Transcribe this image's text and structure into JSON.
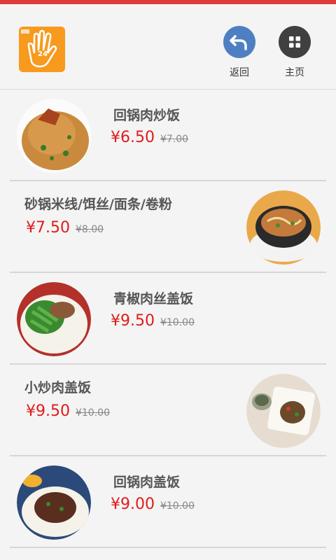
{
  "header": {
    "logo_text": "24 送餐",
    "back_label": "返回",
    "home_label": "主页"
  },
  "items": [
    {
      "name": "回锅肉炒饭",
      "price": "¥6.50",
      "old_price": "¥7.00"
    },
    {
      "name": "砂锅米线/饵丝/面条/卷粉",
      "price": "¥7.50",
      "old_price": "¥8.00"
    },
    {
      "name": "青椒肉丝盖饭",
      "price": "¥9.50",
      "old_price": "¥10.00"
    },
    {
      "name": "小炒肉盖饭",
      "price": "¥9.50",
      "old_price": "¥10.00"
    },
    {
      "name": "回锅肉盖饭",
      "price": "¥9.00",
      "old_price": "¥10.00"
    }
  ],
  "colors": {
    "accent": "#e21b1b",
    "top_bar": "#e03b3b",
    "back_button": "#4f7fc3",
    "home_button": "#404040",
    "logo": "#f79a1e"
  }
}
